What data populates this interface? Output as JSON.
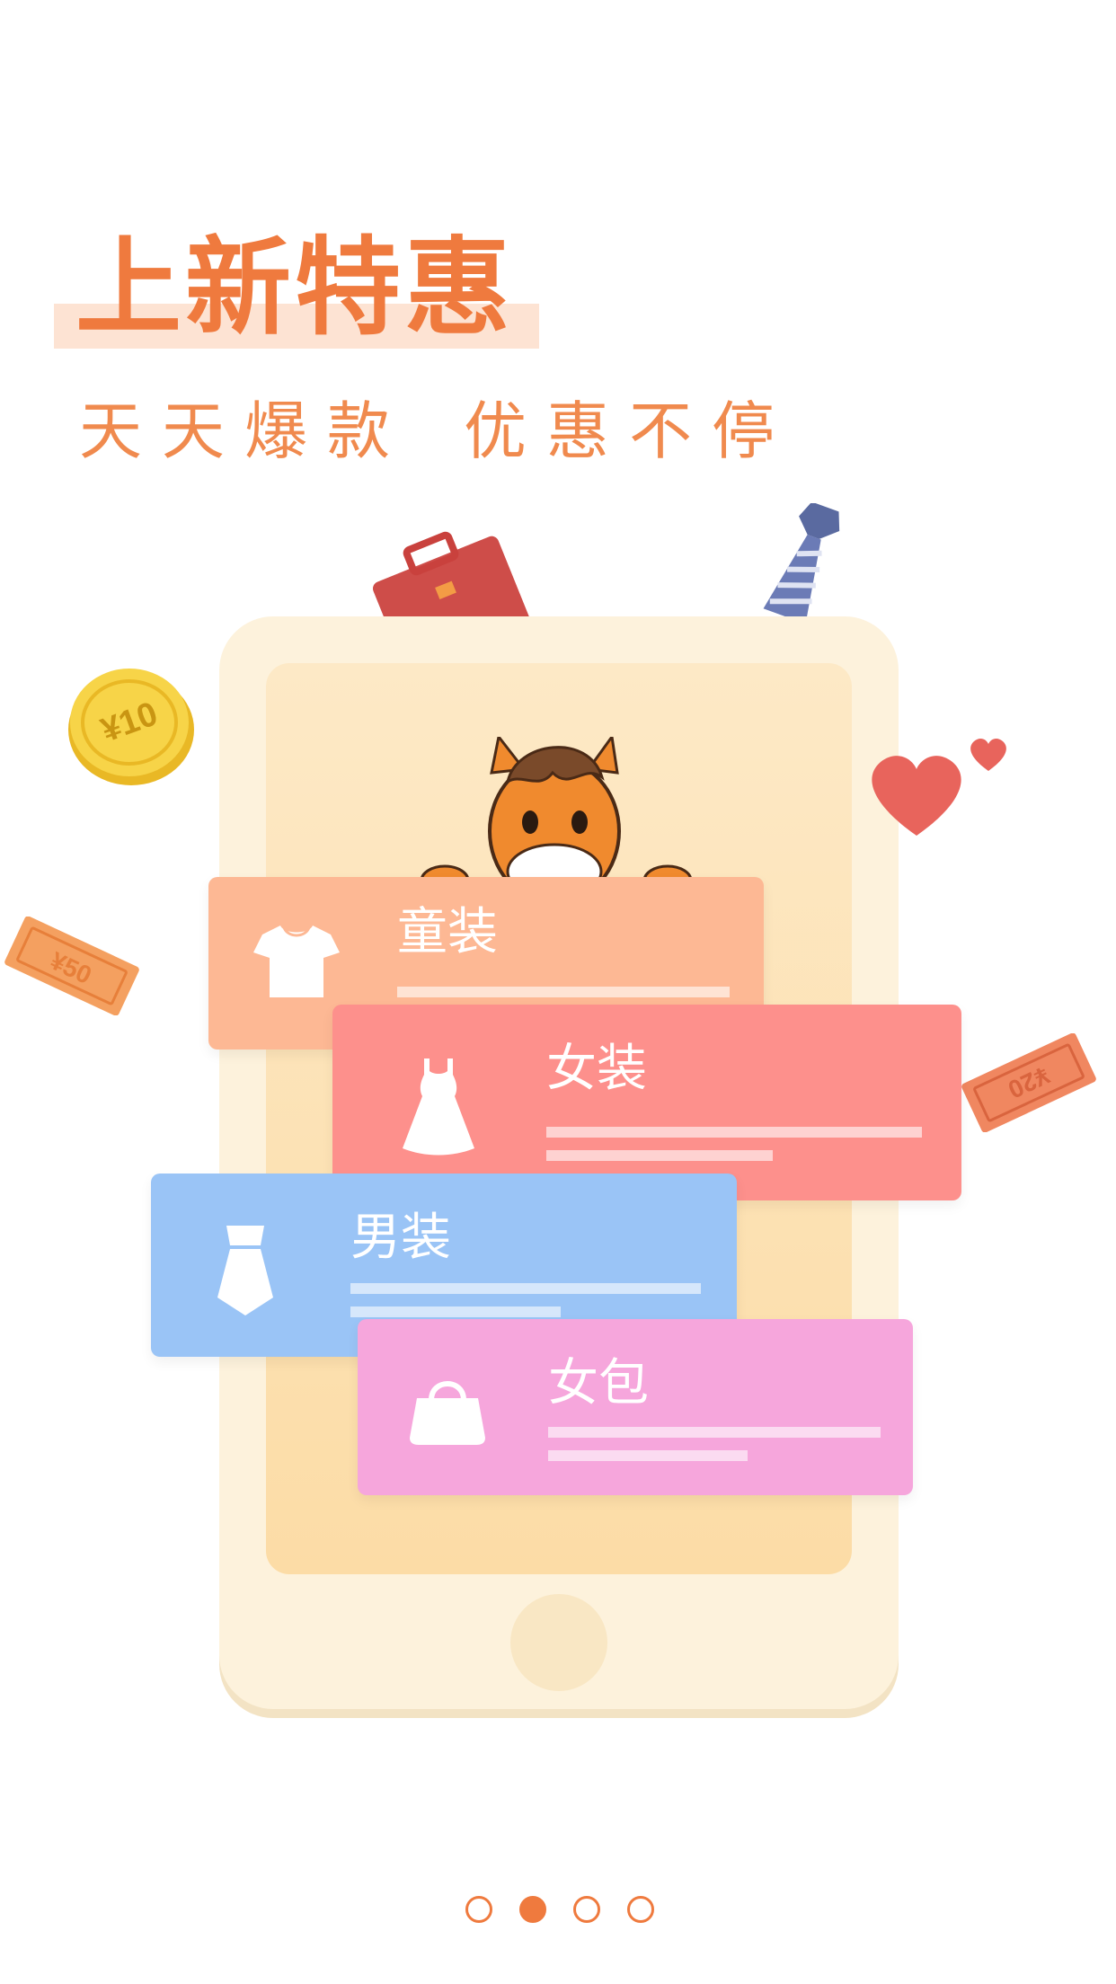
{
  "header": {
    "title": "上新特惠",
    "subtitle_part1": "天天爆款",
    "subtitle_part2": "优惠不停"
  },
  "decorations": {
    "coin_text": "¥10",
    "ticket_left_text": "¥50",
    "ticket_right_text": "¥20"
  },
  "cards": [
    {
      "label": "童装",
      "icon": "tshirt-icon",
      "color": "#fdb894"
    },
    {
      "label": "女装",
      "icon": "dress-icon",
      "color": "#fd908c"
    },
    {
      "label": "男装",
      "icon": "tie-icon",
      "color": "#9ac4f6"
    },
    {
      "label": "女包",
      "icon": "handbag-icon",
      "color": "#f6a6dc"
    }
  ],
  "pager": {
    "total": 4,
    "active": 2
  },
  "colors": {
    "accent": "#ef7a3e",
    "phone_body": "#fdf2dc",
    "screen": "#fcdca6"
  }
}
